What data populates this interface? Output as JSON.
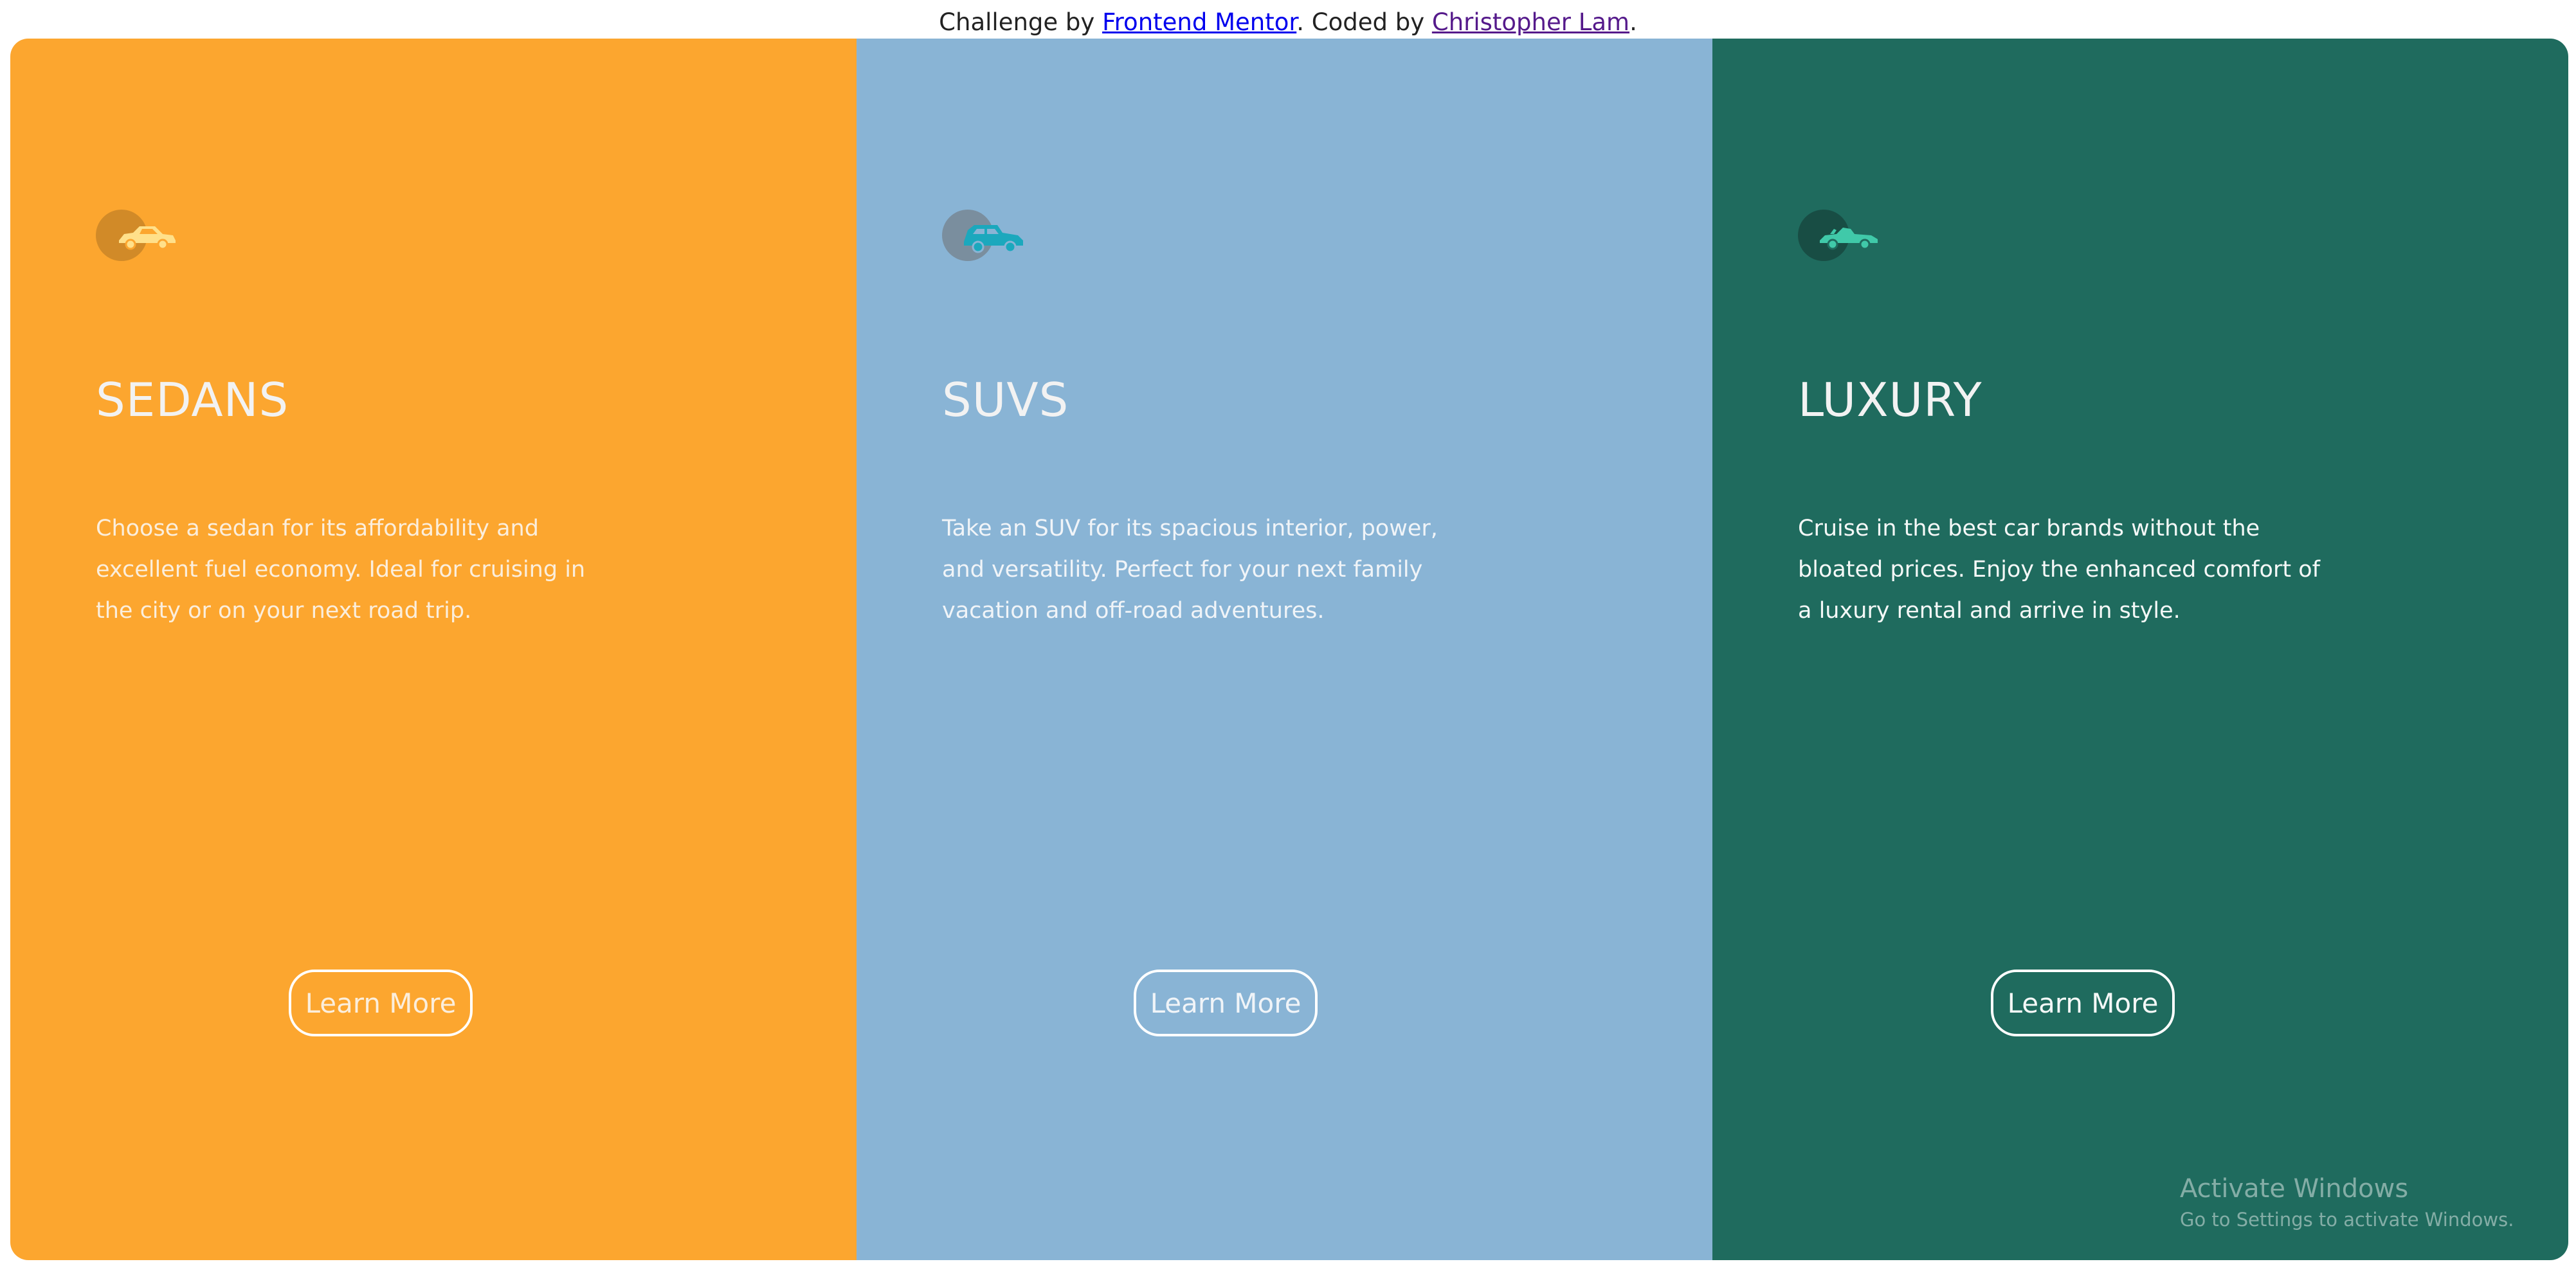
{
  "attribution": {
    "prefix": "Challenge by ",
    "link1": "Frontend Mentor",
    "middle": ". Coded by ",
    "link2": "Christopher Lam",
    "suffix": "."
  },
  "cards": [
    {
      "title": "SEDANS",
      "description": "Choose a sedan for its affordability and excellent fuel economy. Ideal for cruising in the city or on your next road trip.",
      "button": "Learn More",
      "icon": "sedan-icon",
      "bg": "#fca62f",
      "circle": "#d18a28",
      "icon_color": "#ffe08a",
      "text_color": "#fbeedc"
    },
    {
      "title": "SUVS",
      "description": "Take an SUV for its spacious interior, power, and versatility. Perfect for your next family vacation and off-road adventures.",
      "button": "Learn More",
      "icon": "suv-icon",
      "bg": "#89b4d5",
      "circle": "#7a8e9e",
      "icon_color": "#1ba8bd",
      "text_color": "#f0f4f8"
    },
    {
      "title": "LUXURY",
      "description": "Cruise in the best car brands without the bloated prices. Enjoy the enhanced comfort of a luxury rental and arrive in style.",
      "button": "Learn More",
      "icon": "luxury-car-icon",
      "bg": "#1f6b5e",
      "circle": "#184d44",
      "icon_color": "#40c9a9",
      "text_color": "#f4f8f7"
    }
  ],
  "watermark": {
    "line1": "Activate Windows",
    "line2": "Go to Settings to activate Windows."
  }
}
